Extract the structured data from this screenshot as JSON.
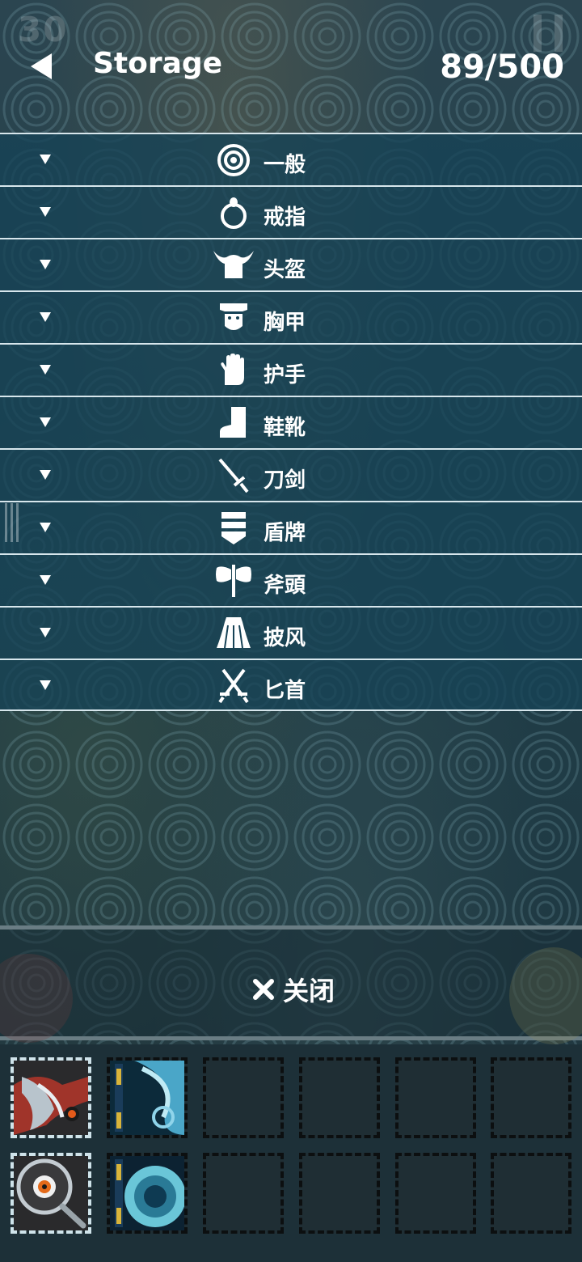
{
  "hud": {
    "level": "30"
  },
  "header": {
    "title": "Storage",
    "capacity": "89/500"
  },
  "categories": [
    {
      "label": "一般",
      "icon": "target-icon"
    },
    {
      "label": "戒指",
      "icon": "ring-icon"
    },
    {
      "label": "头盔",
      "icon": "viking-helmet-icon"
    },
    {
      "label": "胸甲",
      "icon": "chest-armor-icon"
    },
    {
      "label": "护手",
      "icon": "hand-glove-icon"
    },
    {
      "label": "鞋靴",
      "icon": "boot-icon"
    },
    {
      "label": "刀剑",
      "icon": "sword-icon"
    },
    {
      "label": "盾牌",
      "icon": "shield-icon"
    },
    {
      "label": "斧頭",
      "icon": "double-axe-icon"
    },
    {
      "label": "披风",
      "icon": "cape-icon"
    },
    {
      "label": "匕首",
      "icon": "crossed-daggers-icon"
    }
  ],
  "close": {
    "label": "关闭",
    "icon": "close-x-icon"
  },
  "inventory": {
    "slots": [
      {
        "item": "mechanical-claw-item",
        "selected": true
      },
      {
        "item": "blue-wind-spell-item",
        "selected": false
      },
      {
        "item": "",
        "selected": false
      },
      {
        "item": "",
        "selected": false
      },
      {
        "item": "",
        "selected": false
      },
      {
        "item": "",
        "selected": false
      },
      {
        "item": "eye-frying-pan-item",
        "selected": true
      },
      {
        "item": "ice-orb-spell-item",
        "selected": false
      },
      {
        "item": "",
        "selected": false
      },
      {
        "item": "",
        "selected": false
      },
      {
        "item": "",
        "selected": false
      },
      {
        "item": "",
        "selected": false
      }
    ]
  },
  "colors": {
    "row_bg": "#164256",
    "row_border": "#d7e6ec",
    "slot_bg": "#1f2e34",
    "selected_border": "#cfe3ea"
  }
}
